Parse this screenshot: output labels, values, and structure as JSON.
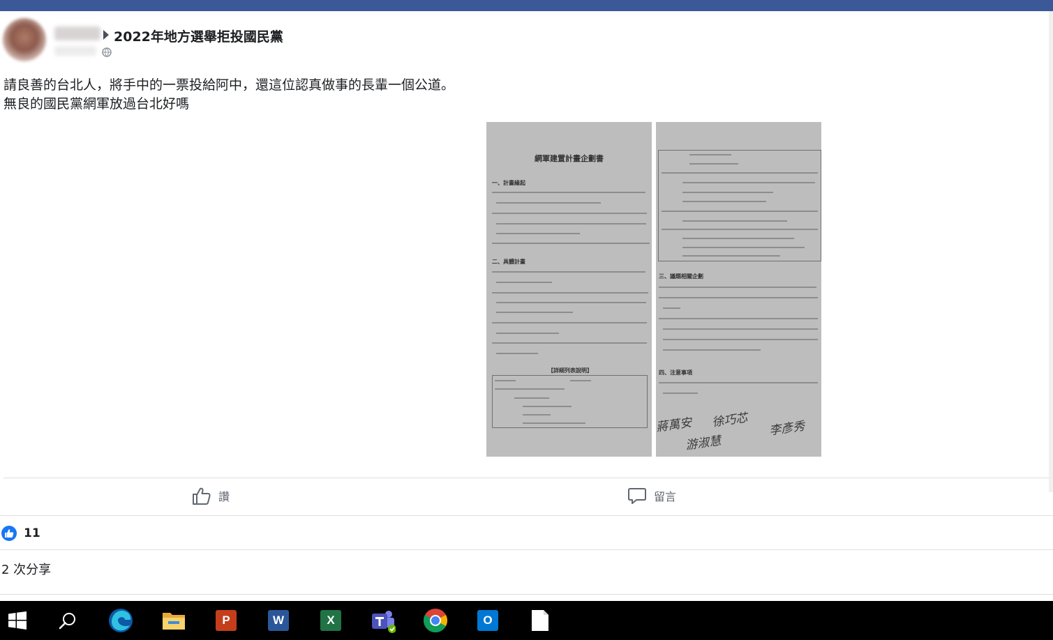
{
  "post": {
    "group_name": "2022年地方選舉拒投國民黨",
    "text_lines": [
      "請良善的台北人，將手中的一票投給阿中，還這位認真做事的長輩一個公道。",
      "無良的國民黨網軍放過台北好嗎"
    ]
  },
  "document": {
    "title": "網軍建置計畫企劃書",
    "sections_left": [
      "一、計畫緣起",
      "二、具體計畫"
    ],
    "table_label": "【詳細列表說明】",
    "sections_right": [
      "三、議題相關企劃",
      "四、注意事項"
    ],
    "signatures": [
      "蔣萬安",
      "徐巧芯",
      "李彥秀",
      "游淑慧"
    ]
  },
  "actions": {
    "like_label": "讚",
    "comment_label": "留言"
  },
  "stats": {
    "like_count": "11",
    "shares_label": "2 次分享"
  },
  "taskbar": {
    "apps": [
      "windows-start",
      "search",
      "edge",
      "file-explorer",
      "powerpoint",
      "word",
      "excel",
      "teams",
      "chrome",
      "outlook",
      "notepad"
    ]
  },
  "colors": {
    "topbar": "#3b5998",
    "like_blue": "#1877f2",
    "text": "#1c1e21",
    "muted": "#606770"
  }
}
